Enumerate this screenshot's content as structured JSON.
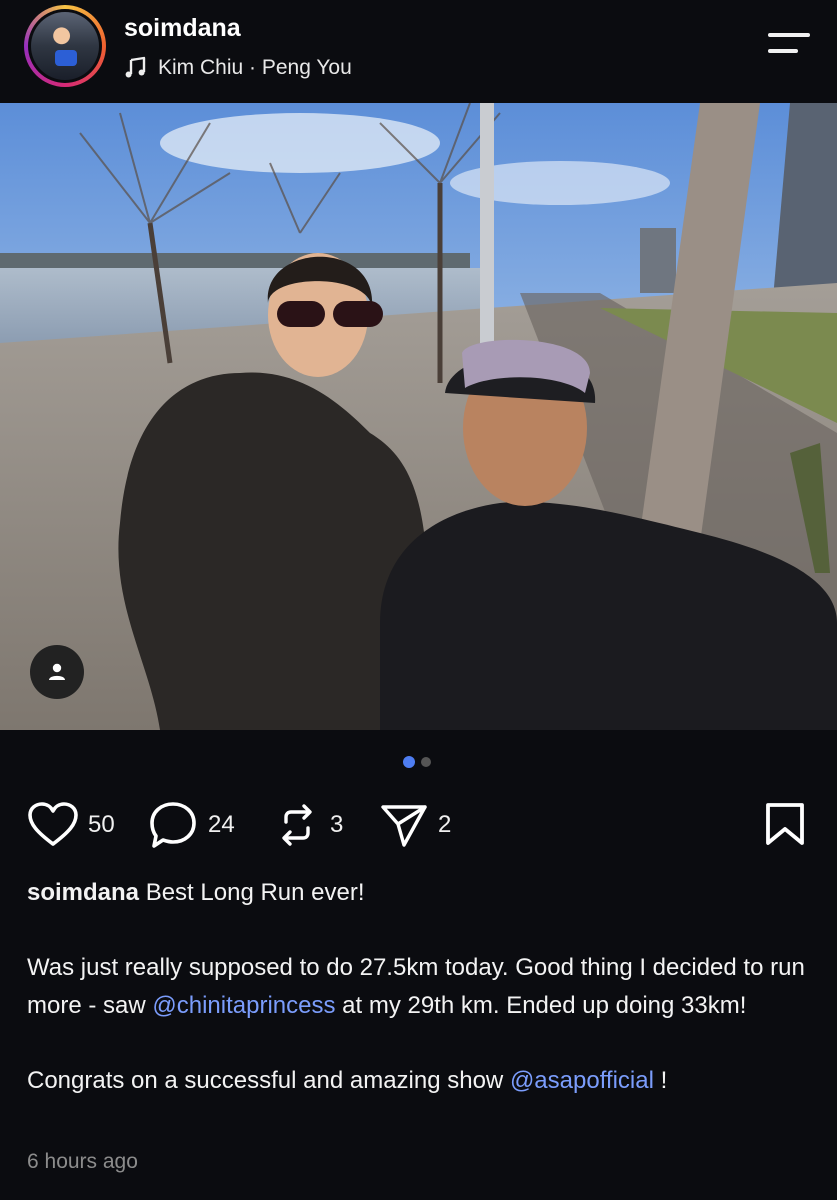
{
  "header": {
    "username": "soimdana",
    "music": "Kim Chiu · Peng You"
  },
  "carousel": {
    "current": 1,
    "total": 2
  },
  "actions": {
    "likes": "50",
    "comments": "24",
    "reposts": "3",
    "shares": "2"
  },
  "caption": {
    "username": "soimdana",
    "title": "Best Long Run ever!",
    "p1_a": "Was just really supposed to do 27.5km today. Good thing I decided to run more - saw ",
    "mention1": "@chinitaprincess",
    "p1_b": " at my 29th km. Ended up doing 33km!",
    "p2_a": "Congrats on a successful and amazing show ",
    "mention2": "@asapofficial",
    "p2_b": " !"
  },
  "timestamp": "6 hours ago",
  "colors": {
    "background": "#0b0c10",
    "mention": "#7b9dfc",
    "active_dot": "#4e7df1"
  }
}
